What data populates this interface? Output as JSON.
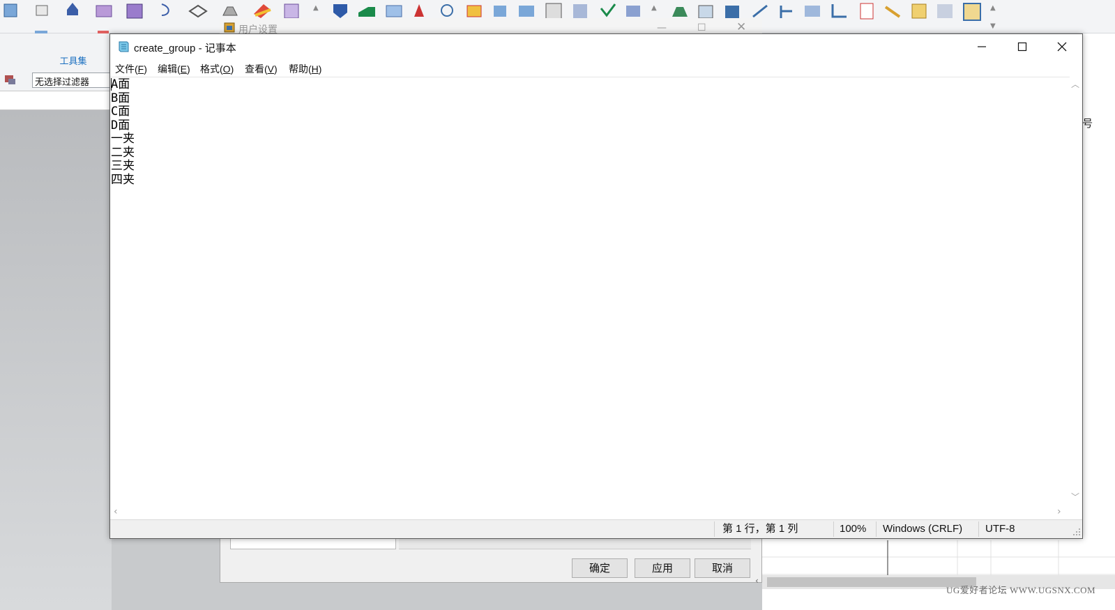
{
  "background_app": {
    "toolset_label": "工具集",
    "filter_value": "无选择过滤器",
    "right_panel_partial_text": "!号",
    "watermark": "UG爱好者论坛 WWW.UGSNX.COM"
  },
  "dialog": {
    "title": "用户设置",
    "buttons": {
      "ok": "确定",
      "apply": "应用",
      "cancel": "取消"
    }
  },
  "notepad": {
    "title": "create_group - 记事本",
    "menu": [
      {
        "label": "文件(",
        "key": "F",
        "tail": ")"
      },
      {
        "label": "编辑(",
        "key": "E",
        "tail": ")"
      },
      {
        "label": "格式(",
        "key": "O",
        "tail": ")"
      },
      {
        "label": "查看(",
        "key": "V",
        "tail": ")"
      },
      {
        "label": "帮助(",
        "key": "H",
        "tail": ")"
      }
    ],
    "lines": [
      "A面",
      "B面",
      "C面",
      "D面",
      "一夹",
      "二夹",
      "三夹",
      "四夹"
    ],
    "status": {
      "position": "第 1 行，第 1 列",
      "zoom": "100%",
      "line_ending": "Windows (CRLF)",
      "encoding": "UTF-8"
    }
  },
  "colors": {
    "accent_blue": "#1a6fc0",
    "window_border": "#5a5a5a"
  },
  "icons": {
    "notepad_icon": "notepad-icon",
    "dialog_icon": "settings-dialog-icon"
  }
}
